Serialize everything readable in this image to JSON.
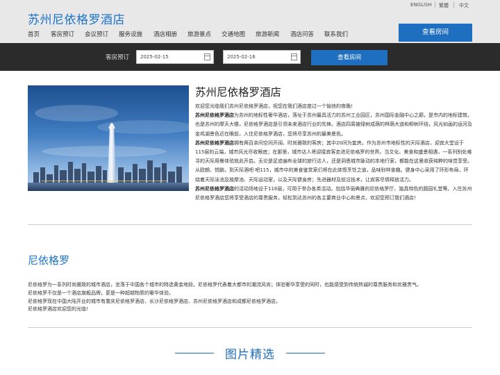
{
  "header": {
    "site_title": "苏州尼依格罗酒店",
    "languages": [
      "ENGLISH",
      "繁體",
      "中文"
    ],
    "nav": [
      "首页",
      "客房预订",
      "会议预订",
      "服务设施",
      "酒店相册",
      "旅游景点",
      "交通地图",
      "旅游新闻",
      "酒店问答",
      "联系我们"
    ],
    "view_rooms_label": "查看房间"
  },
  "booking": {
    "label": "客房预订",
    "checkin": "2025-02-15",
    "checkout": "2025-02-16",
    "view_rooms_label": "查看房间"
  },
  "intro": {
    "title": "苏州尼依格罗酒店",
    "welcome": "欢迎您光临我们苏州尼依格罗酒店，祝您在我们酒店度过一个愉快的夜晚!",
    "p1_bold": "苏州尼依格罗酒店",
    "p1": "为苏州的地标性奢华酒店，落址于苏州最具活力的苏州工业园区，苏州国际金融中心之巅，是市内的地标建筑，也是苏州的摩天大楼，尼依格罗酒店是引领未来酒店行业的先锋。酒店四周被绿树成荫的林荫大道和柳树环绕，风光如画的运河及金鸡湖景色近在眼前，入住尼依格罗酒店，您将尽享苏州的最美景色。",
    "p2_bold": "苏州尼依格罗酒店",
    "p2": "拥有两百余间空间开阔、时尚雅致的客房；其中20间为套房。作为苏州市地标性的天际酒店，迎宾大堂设于115层的云端，城市风光尽收眼底；在那里，城市达人将迎接宾客走进尼依格罗的世界。当文化、美食和盛景相遇，一系列别处难寻的天际用餐体验就此开启。无论是足迹遍布全球的旅行达人，还是洞悉城市脉动的本地行家，都能在这里收获纯粹的味觉享受。从欧朗、悦鹏，到天际酒吧·吧115，城市中的美食鉴赏家们将在此体悟烹饪之道，品味别样食趣。健身中心采用了环形布局，环绕着天际泳池及按摩池、天际运动室，以及天际健身房；先进器材及前沿技术，让宾客尽情释放活力。",
    "p3_bold": "苏州尼依格罗酒店",
    "p3": "的活动场地设于116层，可用于举办各类活动。包括华丽典雅的尼依格罗厅、独具特色的圆园礼堂等。入住苏州尼依格罗酒店您将享受酒店的尊贵服务，轻松到达苏州的各主要商业中心和景点，欢迎您预订我们酒店!"
  },
  "brand": {
    "title": "尼依格罗",
    "lines": [
      "尼依格罗为一系列时尚雅致的城市酒店，坐落于中国各个城市的特选黄金地段。尼依格罗代表着大都市的潮流风尚；体验奢华享受的同时，也能感受到传统热诚的尊贵服务和优雅贵气。",
      "尼依格罗不仅是一个酒店旗舰品牌，更是一种超越物质的奢华体验。",
      "尼依格罗现在中国大陆开业的城市有重庆尼依格罗酒店、长沙尼依格罗酒店、苏州尼依格罗酒店和成都尼依格罗酒店。",
      "尼依格罗酒店欢迎您的光临!"
    ]
  },
  "gallery": {
    "title": "图片精选"
  },
  "colors": {
    "accent": "#1f6fc0",
    "title_blue": "#1a73c9",
    "booking_bg": "#2b2b2b",
    "header_bg": "#e8e8e8"
  }
}
